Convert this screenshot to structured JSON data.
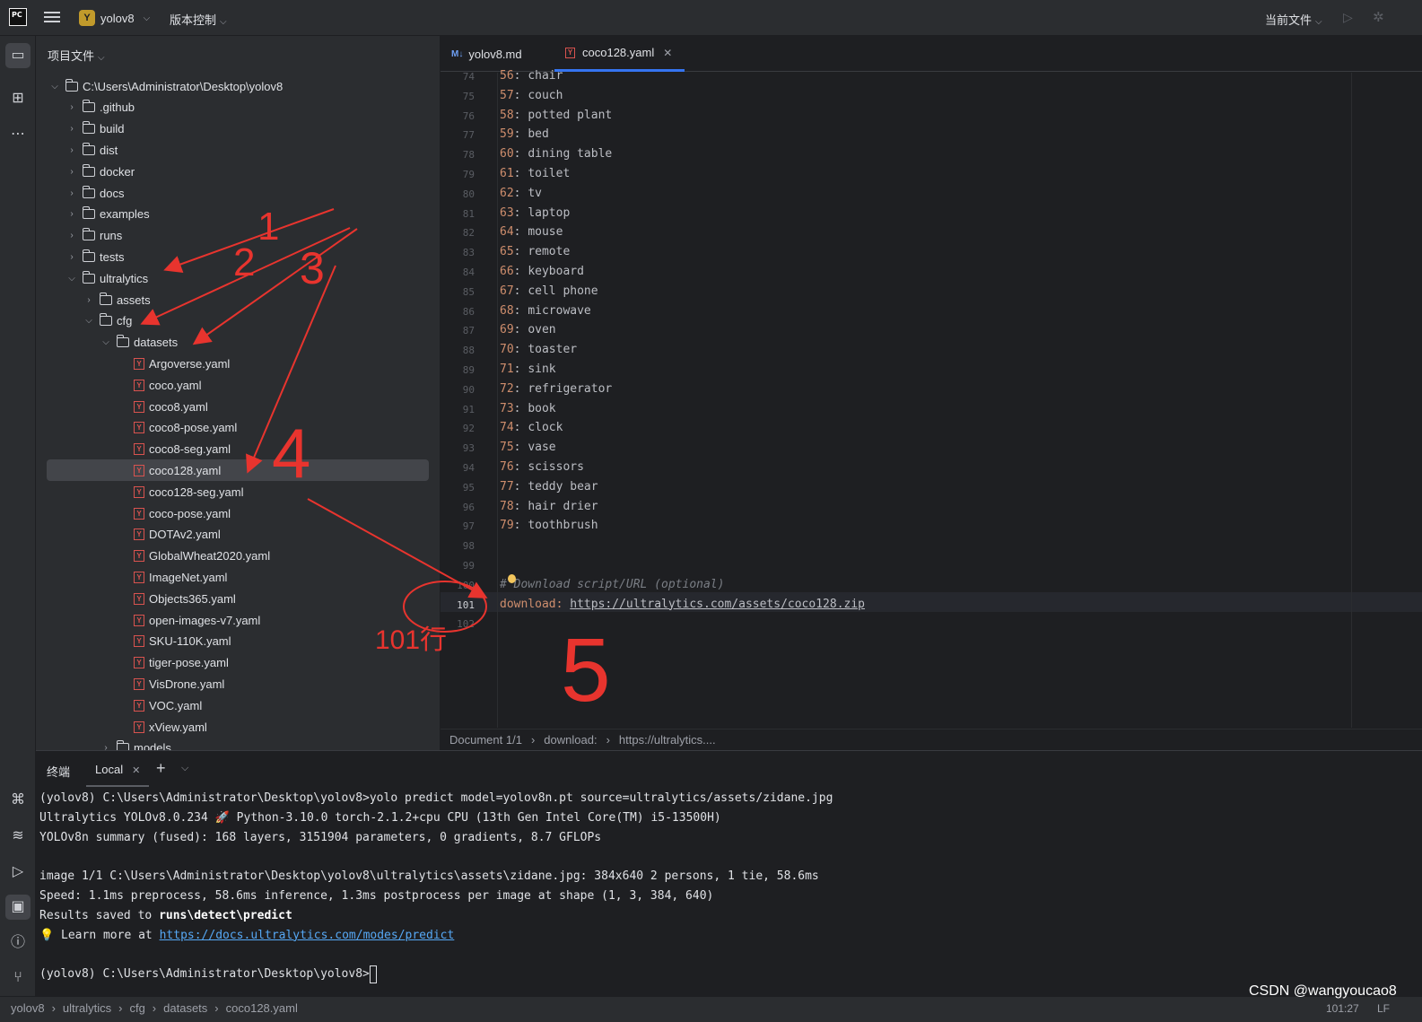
{
  "topbar": {
    "logo": "PC",
    "project_badge": "Y",
    "project_name": "yolov8",
    "vcs": "版本控制",
    "current_file": "当前文件"
  },
  "project_panel": {
    "title": "项目文件",
    "root": "C:\\Users\\Administrator\\Desktop\\yolov8",
    "folders": [
      ".github",
      "build",
      "dist",
      "docker",
      "docs",
      "examples",
      "runs",
      "tests"
    ],
    "ultralytics": "ultralytics",
    "assets": "assets",
    "cfg": "cfg",
    "datasets": "datasets",
    "yaml_files": [
      "Argoverse.yaml",
      "coco.yaml",
      "coco8.yaml",
      "coco8-pose.yaml",
      "coco8-seg.yaml",
      "coco128.yaml",
      "coco128-seg.yaml",
      "coco-pose.yaml",
      "DOTAv2.yaml",
      "GlobalWheat2020.yaml",
      "ImageNet.yaml",
      "Objects365.yaml",
      "open-images-v7.yaml",
      "SKU-110K.yaml",
      "tiger-pose.yaml",
      "VisDrone.yaml",
      "VOC.yaml",
      "xView.yaml"
    ],
    "selected_file": "coco128.yaml",
    "next_folder": "models"
  },
  "editor": {
    "tabs": [
      {
        "label": "yolov8.md",
        "icon": "M↓"
      },
      {
        "label": "coco128.yaml",
        "icon": "Y"
      }
    ],
    "lines": [
      {
        "n": "74",
        "idx": "56",
        "name": "chair"
      },
      {
        "n": "75",
        "idx": "57",
        "name": "couch"
      },
      {
        "n": "76",
        "idx": "58",
        "name": "potted plant"
      },
      {
        "n": "77",
        "idx": "59",
        "name": "bed"
      },
      {
        "n": "78",
        "idx": "60",
        "name": "dining table"
      },
      {
        "n": "79",
        "idx": "61",
        "name": "toilet"
      },
      {
        "n": "80",
        "idx": "62",
        "name": "tv"
      },
      {
        "n": "81",
        "idx": "63",
        "name": "laptop"
      },
      {
        "n": "82",
        "idx": "64",
        "name": "mouse"
      },
      {
        "n": "83",
        "idx": "65",
        "name": "remote"
      },
      {
        "n": "84",
        "idx": "66",
        "name": "keyboard"
      },
      {
        "n": "85",
        "idx": "67",
        "name": "cell phone"
      },
      {
        "n": "86",
        "idx": "68",
        "name": "microwave"
      },
      {
        "n": "87",
        "idx": "69",
        "name": "oven"
      },
      {
        "n": "88",
        "idx": "70",
        "name": "toaster"
      },
      {
        "n": "89",
        "idx": "71",
        "name": "sink"
      },
      {
        "n": "90",
        "idx": "72",
        "name": "refrigerator"
      },
      {
        "n": "91",
        "idx": "73",
        "name": "book"
      },
      {
        "n": "92",
        "idx": "74",
        "name": "clock"
      },
      {
        "n": "93",
        "idx": "75",
        "name": "vase"
      },
      {
        "n": "94",
        "idx": "76",
        "name": "scissors"
      },
      {
        "n": "95",
        "idx": "77",
        "name": "teddy bear"
      },
      {
        "n": "96",
        "idx": "78",
        "name": "hair drier"
      },
      {
        "n": "97",
        "idx": "79",
        "name": "toothbrush"
      }
    ],
    "empty_lines": [
      "98",
      "99"
    ],
    "comment_line_no": "100",
    "comment": "# Download script/URL (optional)",
    "download_line_no": "101",
    "download_key": "download:",
    "download_url": "https://ultralytics.com/assets/coco128.zip",
    "last_line_no": "102",
    "breadcrumb": [
      "Document 1/1",
      "download:",
      "https://ultralytics...."
    ]
  },
  "terminal": {
    "title": "终端",
    "tab": "Local",
    "lines": [
      "(yolov8) C:\\Users\\Administrator\\Desktop\\yolov8>yolo predict model=yolov8n.pt source=ultralytics/assets/zidane.jpg",
      "Ultralytics YOLOv8.0.234 🚀 Python-3.10.0 torch-2.1.2+cpu CPU (13th Gen Intel Core(TM) i5-13500H)",
      "YOLOv8n summary (fused): 168 layers, 3151904 parameters, 0 gradients, 8.7 GFLOPs",
      "",
      "image 1/1 C:\\Users\\Administrator\\Desktop\\yolov8\\ultralytics\\assets\\zidane.jpg: 384x640 2 persons, 1 tie, 58.6ms",
      "Speed: 1.1ms preprocess, 58.6ms inference, 1.3ms postprocess per image at shape (1, 3, 384, 640)"
    ],
    "results_prefix": "Results saved to ",
    "results_path": "runs\\detect\\predict",
    "learn_prefix": "💡 Learn more at ",
    "learn_link": "https://docs.ultralytics.com/modes/predict",
    "prompt": "(yolov8) C:\\Users\\Administrator\\Desktop\\yolov8>"
  },
  "statusbar": {
    "crumbs": [
      "yolov8",
      "ultralytics",
      "cfg",
      "datasets",
      "coco128.yaml"
    ],
    "position": "101:27",
    "line_ending": "LF"
  },
  "annotations": {
    "labels": [
      "1",
      "2",
      "3",
      "4",
      "5"
    ],
    "line_note": "101行",
    "color": "#e8342e"
  },
  "watermark": "CSDN @wangyoucao8"
}
